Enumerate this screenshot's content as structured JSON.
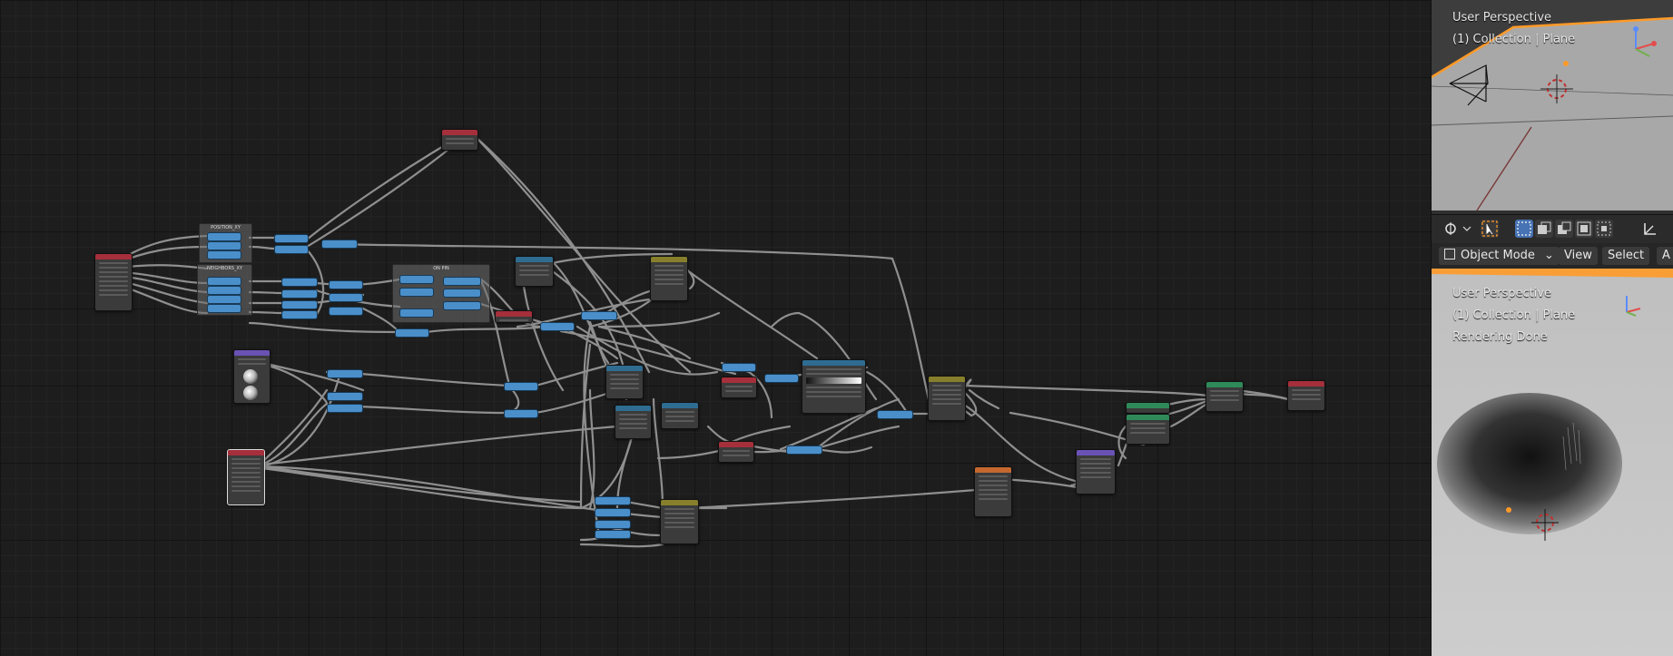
{
  "node_editor": {
    "frames": [
      "POSITION_XY",
      "NEIGHBORS_XY",
      "ON PIN"
    ]
  },
  "viewport_top": {
    "line1": "User Perspective",
    "line2": "(1) Collection | Plane"
  },
  "toolbar": {
    "tools": [
      "view-tool",
      "select-box-tool",
      "select-mode-new",
      "select-mode-extend",
      "select-mode-subtract",
      "select-mode-invert",
      "transform-orientation"
    ]
  },
  "header": {
    "mode": "Object Mode",
    "menus": [
      "View",
      "Select",
      "A"
    ]
  },
  "viewport_bottom": {
    "line1": "User Perspective",
    "line2": "(1) Collection | Plane",
    "line3": "Rendering Done"
  },
  "colors": {
    "grid_bg": "#1d1d1d",
    "node_body": "#3b3b3b",
    "header_input": "#a52f3b",
    "header_vector": "#2f6c91",
    "header_converter": "#877f2c",
    "header_texture": "#c5682f",
    "header_shader": "#2e8a58",
    "header_group": "#6a52b5",
    "reroute": "#4a8fc9",
    "link": "#9c9c9c",
    "selected_outline": "#ff9a28",
    "accent": "#4772b3"
  }
}
